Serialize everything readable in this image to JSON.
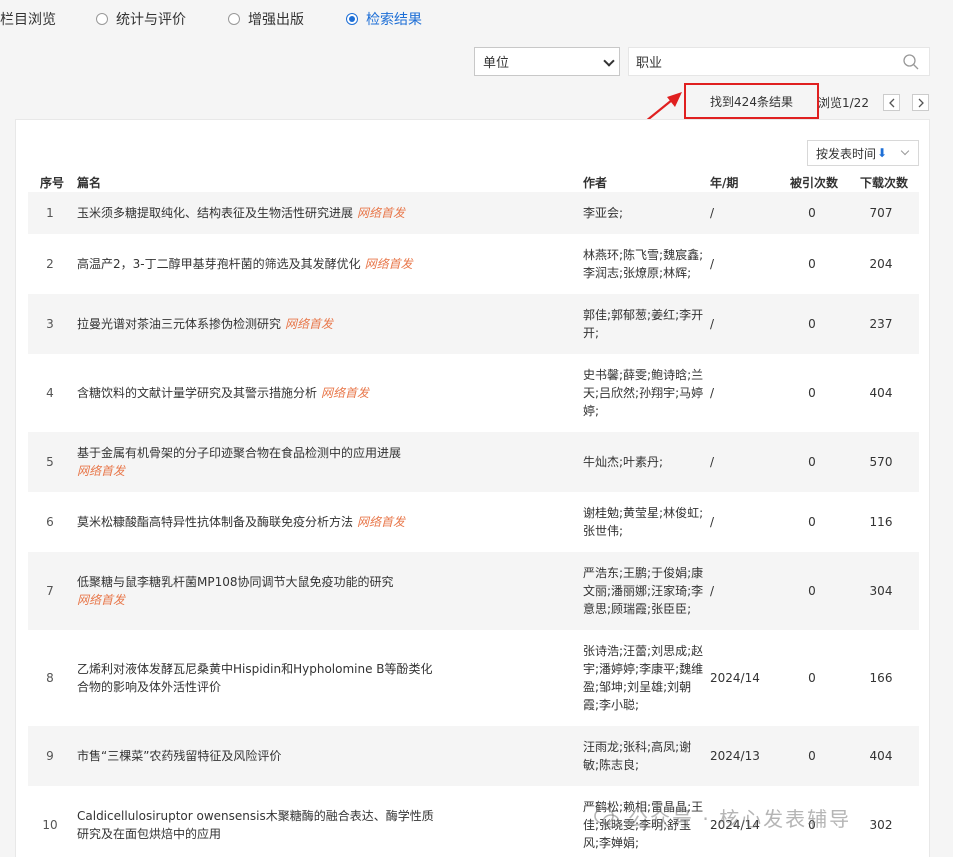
{
  "tabs": {
    "nav_label": "栏目浏览",
    "options": [
      {
        "label": "统计与评价",
        "selected": false
      },
      {
        "label": "增强出版",
        "selected": false
      },
      {
        "label": "检索结果",
        "selected": true
      }
    ]
  },
  "search": {
    "field": "单位",
    "value": "职业"
  },
  "result": {
    "count_text": "找到424条结果",
    "browse_text": "浏览1/22"
  },
  "sort": {
    "label": "按发表时间",
    "arrow": "⬇"
  },
  "table": {
    "headers": {
      "index": "序号",
      "title": "篇名",
      "author": "作者",
      "year": "年/期",
      "cited": "被引次数",
      "downloads": "下载次数"
    },
    "tag_label": "网络首发",
    "rows": [
      {
        "index": "1",
        "title": "玉米须多糖提取纯化、结构表征及生物活性研究进展",
        "tag": true,
        "authors": "李亚会;",
        "year": "/",
        "cited": "0",
        "downloads": "707"
      },
      {
        "index": "2",
        "title": "高温产2，3-丁二醇甲基芽孢杆菌的筛选及其发酵优化",
        "tag": true,
        "authors": "林燕环;陈飞雪;魏宸鑫;李润志;张燎原;林辉;",
        "year": "/",
        "cited": "0",
        "downloads": "204"
      },
      {
        "index": "3",
        "title": "拉曼光谱对茶油三元体系掺伪检测研究",
        "tag": true,
        "authors": "郭佳;郭郁葱;姜红;李开开;",
        "year": "/",
        "cited": "0",
        "downloads": "237"
      },
      {
        "index": "4",
        "title": "含糖饮料的文献计量学研究及其警示措施分析",
        "tag": true,
        "authors": "史书馨;薛雯;鲍诗晗;兰天;吕欣然;孙翔宇;马婷婷;",
        "year": "/",
        "cited": "0",
        "downloads": "404"
      },
      {
        "index": "5",
        "title": "基于金属有机骨架的分子印迹聚合物在食品检测中的应用进展",
        "tag": true,
        "authors": "牛灿杰;叶素丹;",
        "year": "/",
        "cited": "0",
        "downloads": "570"
      },
      {
        "index": "6",
        "title": "莫米松糠酸酯高特异性抗体制备及酶联免疫分析方法",
        "tag": true,
        "authors": "谢桂勉;黄莹星;林俊虹;张世伟;",
        "year": "/",
        "cited": "0",
        "downloads": "116"
      },
      {
        "index": "7",
        "title": "低聚糖与鼠李糖乳杆菌MP108协同调节大鼠免疫功能的研究",
        "tag": true,
        "authors": "严浩东;王鹏;于俊娟;康文丽;潘丽娜;汪家琦;李意思;顾瑞霞;张臣臣;",
        "year": "/",
        "cited": "0",
        "downloads": "304"
      },
      {
        "index": "8",
        "title": "乙烯利对液体发酵瓦尼桑黄中Hispidin和Hypholomine B等酚类化合物的影响及体外活性评价",
        "tag": false,
        "authors": "张诗浩;汪蕾;刘思成;赵宇;潘婷婷;李康平;魏维盈;邹坤;刘呈雄;刘朝霞;李小聪;",
        "year": "2024/14",
        "cited": "0",
        "downloads": "166"
      },
      {
        "index": "9",
        "title": "市售“三棵菜”农药残留特征及风险评价",
        "tag": false,
        "authors": "汪雨龙;张科;高凤;谢敏;陈志良;",
        "year": "2024/13",
        "cited": "0",
        "downloads": "404"
      },
      {
        "index": "10",
        "title": "Caldicellulosiruptor owensensis木聚糖酶的融合表达、酶学性质研究及在面包烘焙中的应用",
        "tag": false,
        "authors": "严鹤松;赖相;雷晶晶;王佳;张晓雯;李明;舒玉风;李婵娟;",
        "year": "2024/14",
        "cited": "0",
        "downloads": "302"
      }
    ]
  },
  "watermark": "公众号 · 核心发表辅导"
}
